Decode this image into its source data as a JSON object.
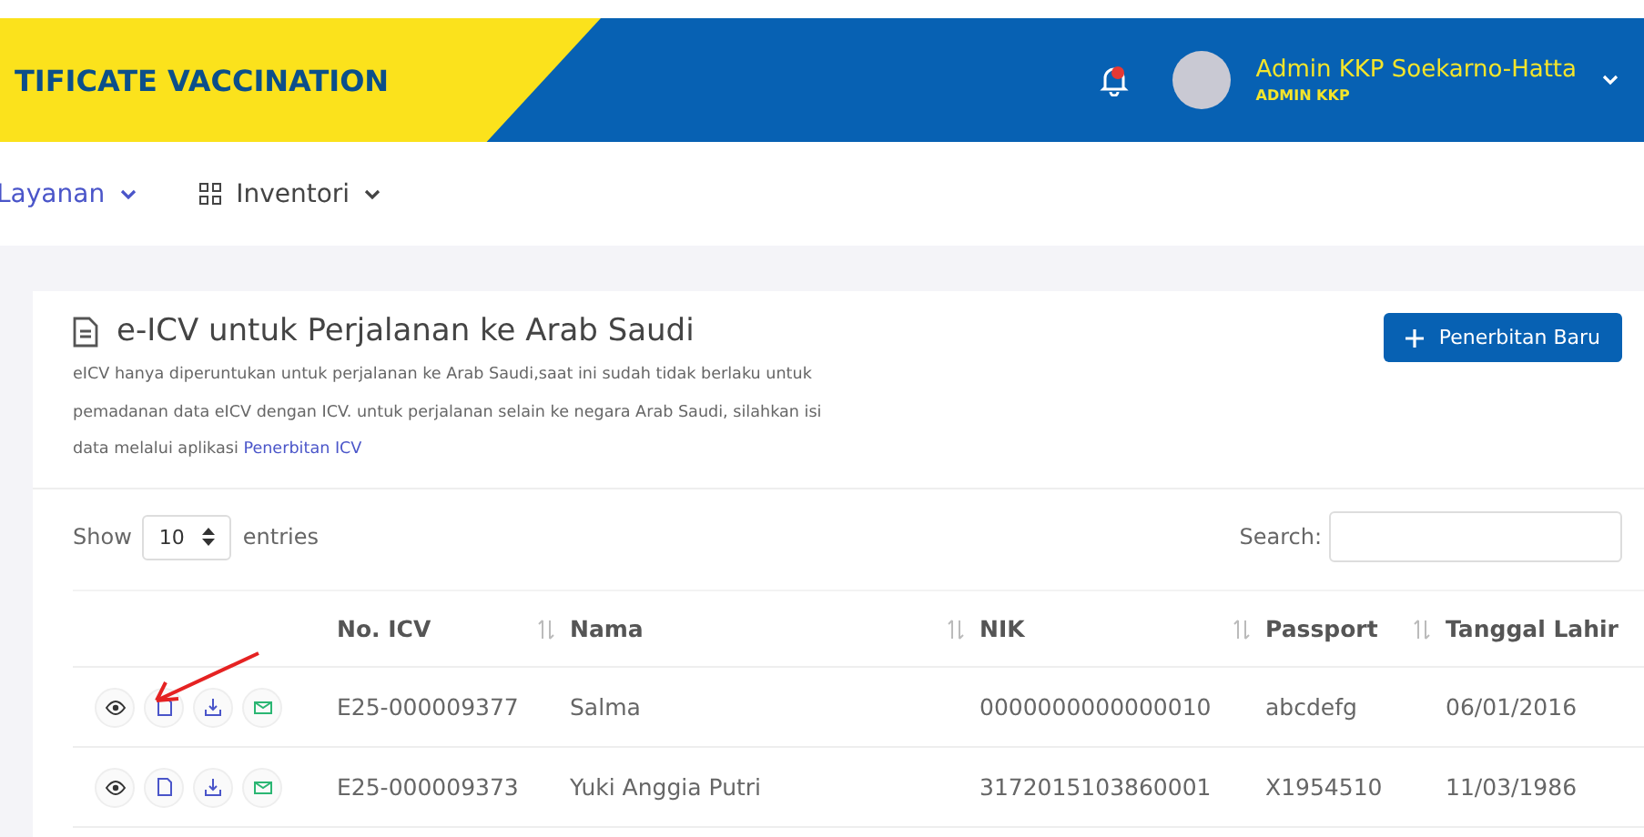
{
  "header": {
    "title": "TIFICATE VACCINATION",
    "user_name": "Admin KKP Soekarno-Hatta",
    "user_role": "ADMIN KKP"
  },
  "nav": [
    {
      "label": "Layanan",
      "kind": "text"
    },
    {
      "label": "Inventori",
      "kind": "grid"
    }
  ],
  "card": {
    "title": "e-ICV untuk Perjalanan ke Arab Saudi",
    "description": "eICV hanya diperuntukan untuk perjalanan ke Arab Saudi,saat ini sudah tidak berlaku untuk pemadanan data eICV dengan ICV. untuk perjalanan selain ke negara Arab Saudi, silahkan isi data melalui aplikasi ",
    "link": "Penerbitan ICV",
    "button": "Penerbitan Baru"
  },
  "table": {
    "show_label": "Show",
    "page_size": "10",
    "entries_label": "entries",
    "search_label": "Search:",
    "columns": [
      "No. ICV",
      "Nama",
      "NIK",
      "Passport",
      "Tanggal Lahir"
    ],
    "rows": [
      {
        "no_icv": "E25-000009377",
        "nama": "Salma",
        "nik": "0000000000000010",
        "passport": "abcdefg",
        "tanggal_lahir": "06/01/2016"
      },
      {
        "no_icv": "E25-000009373",
        "nama": "Yuki Anggia Putri",
        "nik": "3172015103860001",
        "passport": "X1954510",
        "tanggal_lahir": "11/03/1986"
      }
    ]
  }
}
